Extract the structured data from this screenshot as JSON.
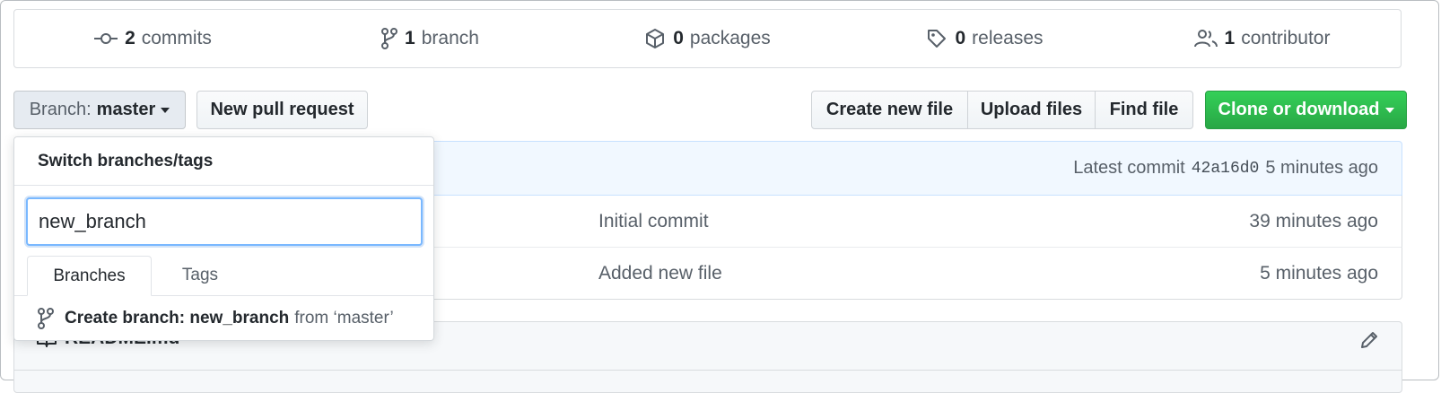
{
  "summary": {
    "commits": {
      "icon": "commit-icon",
      "count": "2",
      "label": "commits"
    },
    "branches": {
      "icon": "branch-icon",
      "count": "1",
      "label": "branch"
    },
    "packages": {
      "icon": "package-icon",
      "count": "0",
      "label": "packages"
    },
    "releases": {
      "icon": "tag-icon",
      "count": "0",
      "label": "releases"
    },
    "contributors": {
      "icon": "people-icon",
      "count": "1",
      "label": "contributor"
    }
  },
  "toolbar": {
    "branch_prefix": "Branch:",
    "branch_name": "master",
    "new_pull_request": "New pull request",
    "create_new_file": "Create new file",
    "upload_files": "Upload files",
    "find_file": "Find file",
    "clone_or_download": "Clone or download"
  },
  "commit_tease": {
    "label": "Latest commit",
    "sha": "42a16d0",
    "age": "5 minutes ago"
  },
  "files": [
    {
      "message": "Initial commit",
      "age": "39 minutes ago"
    },
    {
      "message": "Added new file",
      "age": "5 minutes ago"
    }
  ],
  "readme": {
    "icon": "book-icon",
    "title": "README.md",
    "edit_icon": "pencil-icon"
  },
  "branch_menu": {
    "title": "Switch branches/tags",
    "filter_value": "new_branch",
    "tabs": {
      "branches": "Branches",
      "tags": "Tags"
    },
    "create_prefix": "Create branch: new_branch",
    "create_suffix": "from ‘master’"
  },
  "colors": {
    "primary_green": "#28a745",
    "focus_blue": "#79b8ff",
    "tease_bg": "#f1f8ff",
    "text_muted": "#586069"
  }
}
